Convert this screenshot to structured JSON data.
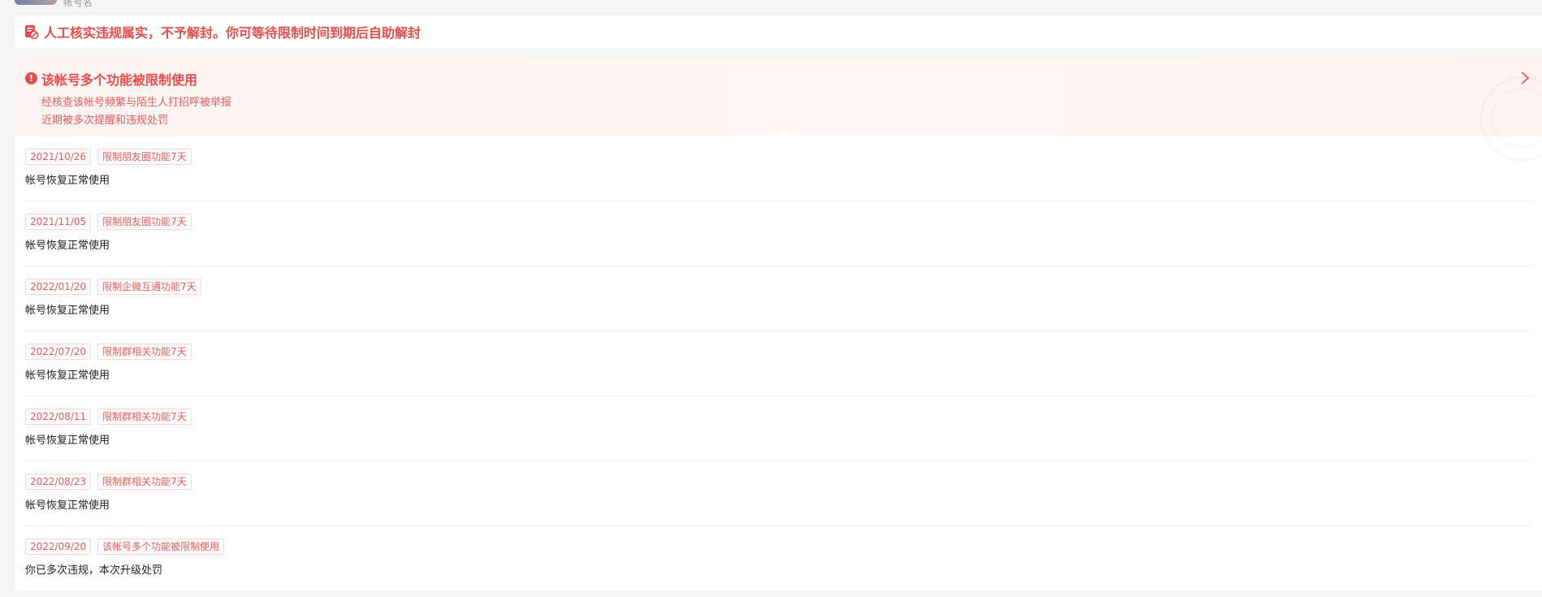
{
  "header": {
    "avatar_name": "帐号名"
  },
  "banner": {
    "icon": "document-ban-icon",
    "text": "人工核实违规属实，不予解封。你可等待限制时间到期后自助解封",
    "color": "#e54d4d"
  },
  "alert": {
    "icon": "exclamation-circle-icon",
    "title": "该帐号多个功能被限制使用",
    "line1": "经核查该帐号频繁与陌生人打招呼被举报",
    "line2": "近期被多次提醒和违规处罚",
    "chevron_icon": "chevron-right-icon"
  },
  "records": [
    {
      "date": "2021/10/26",
      "restriction": "限制朋友圈功能7天",
      "status": "帐号恢复正常使用"
    },
    {
      "date": "2021/11/05",
      "restriction": "限制朋友圈功能7天",
      "status": "帐号恢复正常使用"
    },
    {
      "date": "2022/01/20",
      "restriction": "限制企微互通功能7天",
      "status": "帐号恢复正常使用"
    },
    {
      "date": "2022/07/20",
      "restriction": "限制群相关功能7天",
      "status": "帐号恢复正常使用"
    },
    {
      "date": "2022/08/11",
      "restriction": "限制群相关功能7天",
      "status": "帐号恢复正常使用"
    },
    {
      "date": "2022/08/23",
      "restriction": "限制群相关功能7天",
      "status": "帐号恢复正常使用"
    },
    {
      "date": "2022/09/20",
      "restriction": "该帐号多个功能被限制使用",
      "status": "你已多次违规，本次升级处罚"
    }
  ]
}
